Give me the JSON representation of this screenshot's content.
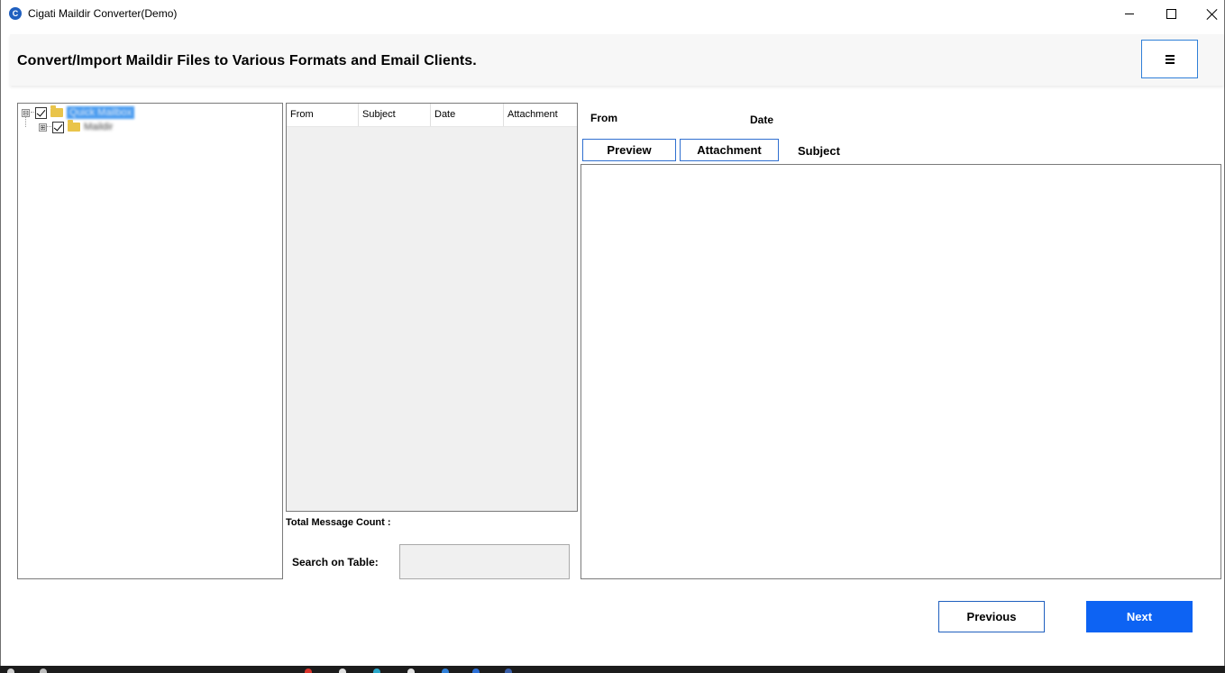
{
  "window": {
    "title": "Cigati Maildir Converter(Demo)",
    "icon_letter": "C"
  },
  "header": {
    "title": "Convert/Import Maildir Files to Various Formats and Email Clients."
  },
  "tree": {
    "nodes": [
      {
        "label": "Quick Mailbox",
        "expander": "⊟",
        "checked": true,
        "selected": true
      },
      {
        "label": "Maildir",
        "expander": "⊞",
        "checked": true,
        "selected": false
      }
    ]
  },
  "mail_list": {
    "columns": [
      "From",
      "Subject",
      "Date",
      "Attachment"
    ],
    "total_message_count_label": "Total Message Count :",
    "search_label": "Search on Table:",
    "search_value": ""
  },
  "preview": {
    "from_label": "From",
    "date_label": "Date",
    "subject_label": "Subject",
    "tabs": [
      "Preview",
      "Attachment"
    ]
  },
  "footer": {
    "previous_label": "Previous",
    "next_label": "Next"
  },
  "colors": {
    "accent_blue": "#0d63f3",
    "border_blue": "#2f6fd0",
    "selection_blue": "#4c9df0"
  }
}
